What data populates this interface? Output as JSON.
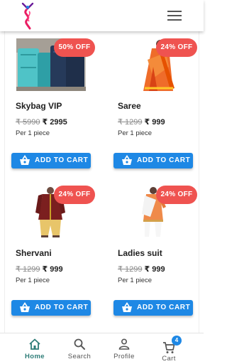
{
  "app_bar": {
    "logo": "brand-logo",
    "menu_icon": "hamburger-menu-icon"
  },
  "products": [
    {
      "name": "Skybag VIP",
      "discount": "50% OFF",
      "old_price": "₹ 5990",
      "new_price": "₹ 2995",
      "unit": "Per 1 piece",
      "button": "ADD TO CART"
    },
    {
      "name": "Saree",
      "discount": "24% OFF",
      "old_price": "₹ 1299",
      "new_price": "₹ 999",
      "unit": "Per 1 piece",
      "button": "ADD TO CART"
    },
    {
      "name": "Shervani",
      "discount": "24% OFF",
      "old_price": "₹ 1299",
      "new_price": "₹ 999",
      "unit": "Per 1 piece",
      "button": "ADD TO CART"
    },
    {
      "name": "Ladies suit",
      "discount": "24% OFF",
      "old_price": "₹ 1299",
      "new_price": "₹ 999",
      "unit": "Per 1 piece",
      "button": "ADD TO CART"
    }
  ],
  "bottom_nav": {
    "items": [
      {
        "label": "Home",
        "icon": "home-icon",
        "active": true
      },
      {
        "label": "Search",
        "icon": "search-icon",
        "active": false
      },
      {
        "label": "Profile",
        "icon": "profile-icon",
        "active": false
      },
      {
        "label": "Cart",
        "icon": "cart-icon",
        "active": false,
        "badge": "4"
      }
    ]
  },
  "colors": {
    "primary": "#1e88e5",
    "badge": "#ef5350",
    "active_nav": "#2e7d78"
  }
}
